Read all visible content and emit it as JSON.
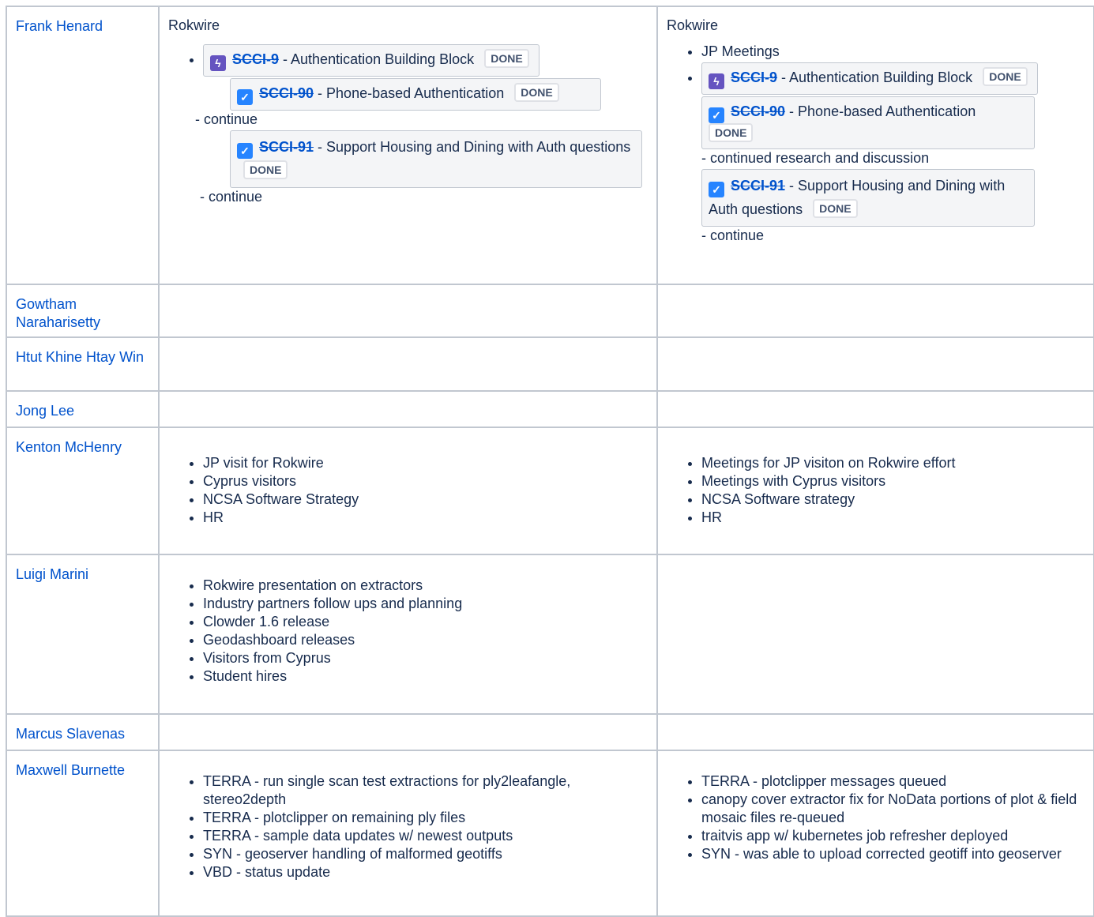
{
  "rows": [
    {
      "name": "Frank Henard",
      "col2": {
        "title": "Rokwire",
        "epic": {
          "key": "SCCI-9",
          "summary": "- Authentication Building Block",
          "status": "DONE"
        },
        "sub": [
          {
            "key": "SCCI-90",
            "summary": "- Phone-based Authentication",
            "status": "DONE",
            "note": "- continue"
          },
          {
            "key": "SCCI-91",
            "summary": "- Support Housing and Dining with Auth questions",
            "status": "DONE",
            "note": "- continue"
          }
        ]
      },
      "col3": {
        "title": "Rokwire",
        "first_item": "JP Meetings",
        "epic": {
          "key": "SCCI-9",
          "summary": "- Authentication Building Block",
          "status": "DONE"
        },
        "sub": [
          {
            "key": "SCCI-90",
            "summary": "- Phone-based Authentication",
            "status": "DONE",
            "note": "- continued research and discussion"
          },
          {
            "key": "SCCI-91",
            "summary": "- Support Housing and Dining with Auth questions",
            "status": "DONE",
            "note": "- continue"
          }
        ]
      }
    },
    {
      "name": "Gowtham Naraharisetty"
    },
    {
      "name": "Htut Khine Htay Win"
    },
    {
      "name": "Jong Lee"
    },
    {
      "name": "Kenton McHenry",
      "col2": [
        "JP visit for Rokwire",
        "Cyprus visitors",
        "NCSA Software Strategy",
        "HR"
      ],
      "col3": [
        "Meetings for JP visiton on Rokwire effort",
        "Meetings with Cyprus visitors",
        "NCSA Software strategy",
        "HR"
      ]
    },
    {
      "name": "Luigi Marini",
      "col2": [
        "Rokwire presentation on extractors",
        "Industry partners follow ups and planning",
        "Clowder 1.6 release",
        "Geodashboard releases",
        "Visitors from Cyprus",
        "Student hires"
      ]
    },
    {
      "name": "Marcus Slavenas"
    },
    {
      "name": "Maxwell Burnette",
      "col2": [
        "TERRA - run single scan test extractions for ply2leafangle, stereo2depth",
        "TERRA - plotclipper on remaining ply files",
        "TERRA - sample data updates w/ newest outputs",
        "SYN - geoserver handling of malformed geotiffs",
        "VBD - status update"
      ],
      "col3": [
        "TERRA - plotclipper messages queued",
        "canopy cover extractor fix for NoData portions of plot & field mosaic files re-queued",
        "traitvis app w/ kubernetes job refresher deployed",
        "SYN - was able to upload corrected geotiff into geoserver"
      ]
    }
  ]
}
